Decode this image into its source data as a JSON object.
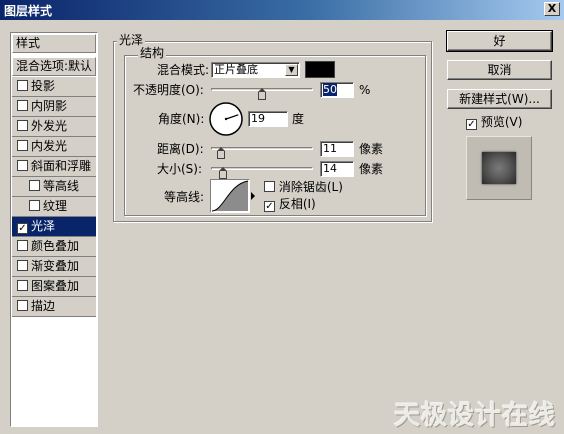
{
  "window": {
    "title": "图层样式",
    "close_label": "X"
  },
  "left_panel": {
    "header": "样式",
    "blend_options": "混合选项:默认",
    "items": [
      {
        "label": "投影",
        "checked": false,
        "indent": false,
        "selected": false
      },
      {
        "label": "内阴影",
        "checked": false,
        "indent": false,
        "selected": false
      },
      {
        "label": "外发光",
        "checked": false,
        "indent": false,
        "selected": false
      },
      {
        "label": "内发光",
        "checked": false,
        "indent": false,
        "selected": false
      },
      {
        "label": "斜面和浮雕",
        "checked": false,
        "indent": false,
        "selected": false
      },
      {
        "label": "等高线",
        "checked": false,
        "indent": true,
        "selected": false
      },
      {
        "label": "纹理",
        "checked": false,
        "indent": true,
        "selected": false
      },
      {
        "label": "光泽",
        "checked": true,
        "indent": false,
        "selected": true
      },
      {
        "label": "颜色叠加",
        "checked": false,
        "indent": false,
        "selected": false
      },
      {
        "label": "渐变叠加",
        "checked": false,
        "indent": false,
        "selected": false
      },
      {
        "label": "图案叠加",
        "checked": false,
        "indent": false,
        "selected": false
      },
      {
        "label": "描边",
        "checked": false,
        "indent": false,
        "selected": false
      }
    ]
  },
  "satin": {
    "title": "光泽",
    "structure": "结构",
    "blend_mode_label": "混合模式:",
    "blend_mode_value": "正片叠底",
    "swatch_color": "#000000",
    "opacity_label": "不透明度(O):",
    "opacity_value": "50",
    "opacity_unit": "%",
    "opacity_fraction": 0.5,
    "angle_label": "角度(N):",
    "angle_value": "19",
    "angle_unit": "度",
    "distance_label": "距离(D):",
    "distance_value": "11",
    "distance_unit": "像素",
    "size_label": "大小(S):",
    "size_value": "14",
    "size_unit": "像素",
    "contour_label": "等高线:",
    "antialias_label": "消除锯齿(L)",
    "antialias_checked": false,
    "invert_label": "反相(I)",
    "invert_checked": true
  },
  "buttons": {
    "ok": "好",
    "cancel": "取消",
    "new_style": "新建样式(W)..."
  },
  "preview": {
    "label": "预览(V)",
    "checked": true
  },
  "watermark": "天极设计在线",
  "colors": {
    "selected_bg": "#0a246a",
    "dialog_bg": "#d4d0c8",
    "title_start": "#0a246a",
    "title_end": "#a6caf0"
  }
}
